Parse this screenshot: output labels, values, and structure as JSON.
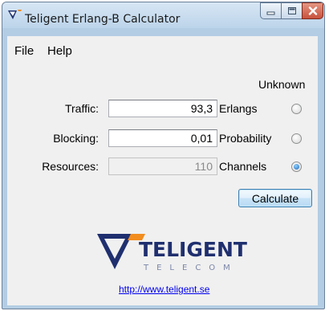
{
  "window": {
    "title": "Teligent Erlang-B Calculator"
  },
  "menu": {
    "items": [
      {
        "label": "File"
      },
      {
        "label": "Help"
      }
    ]
  },
  "form": {
    "unknown_header": "Unknown",
    "rows": [
      {
        "label": "Traffic:",
        "value": "93,3",
        "unit": "Erlangs",
        "selected": false,
        "editable": true
      },
      {
        "label": "Blocking:",
        "value": "0,01",
        "unit": "Probability",
        "selected": false,
        "editable": true
      },
      {
        "label": "Resources:",
        "value": "110",
        "unit": "Channels",
        "selected": true,
        "editable": false
      }
    ],
    "calculate_label": "Calculate"
  },
  "branding": {
    "logo_text": "TELIGENT",
    "logo_subtext": "TELECOM",
    "link": "http://www.teligent.se",
    "colors": {
      "navy": "#1f2f6f",
      "orange": "#f28c1e",
      "sub": "#7b86a8"
    }
  }
}
